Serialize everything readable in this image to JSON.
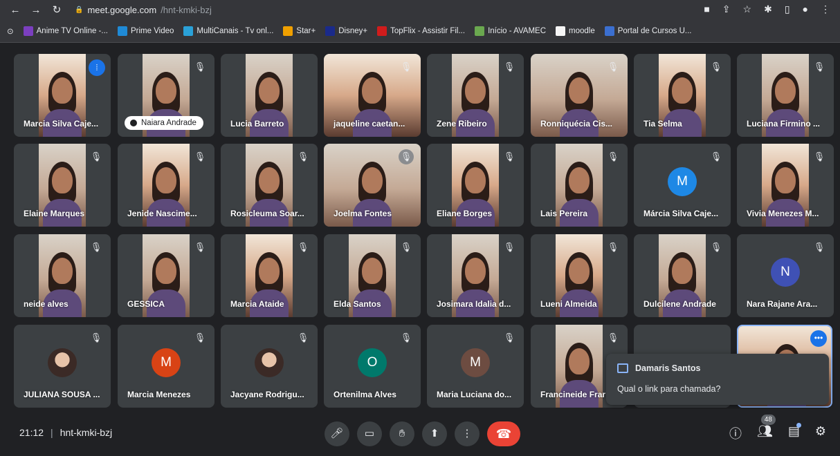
{
  "browser": {
    "url_domain": "meet.google.com",
    "url_path": "/hnt-kmki-bzj",
    "bookmarks": [
      {
        "label": "Anime TV Online -...",
        "color": "#7b3fbf"
      },
      {
        "label": "Prime Video",
        "color": "#1f8ad6"
      },
      {
        "label": "MultiCanais - Tv onl...",
        "color": "#2aa1d8"
      },
      {
        "label": "Star+",
        "color": "#f0a000"
      },
      {
        "label": "Disney+",
        "color": "#1a2a8a"
      },
      {
        "label": "TopFlix - Assistir Fil...",
        "color": "#d01c1c"
      },
      {
        "label": "Início - AVAMEC",
        "color": "#6aa84f"
      },
      {
        "label": "moodle",
        "color": "#f5f5f5"
      },
      {
        "label": "Portal de Cursos U...",
        "color": "#3b6fd0"
      }
    ]
  },
  "participants": [
    {
      "name": "Marcia Silva Caje...",
      "type": "video",
      "status": "speaking"
    },
    {
      "name": "Naiara Andrade",
      "type": "video",
      "status": "pinned"
    },
    {
      "name": "Lucia Barreto",
      "type": "video",
      "status": "none"
    },
    {
      "name": "jaqueline caetan...",
      "type": "video",
      "status": "muted"
    },
    {
      "name": "Zene Ribeiro",
      "type": "video",
      "status": "muted"
    },
    {
      "name": "Ronniquécia Cis...",
      "type": "video",
      "status": "muted"
    },
    {
      "name": "Tia Selma",
      "type": "video",
      "status": "muted"
    },
    {
      "name": "Luciana Firmino ...",
      "type": "video",
      "status": "muted"
    },
    {
      "name": "Elaine Marques",
      "type": "video",
      "status": "muted"
    },
    {
      "name": "Jenide Nascime...",
      "type": "video",
      "status": "muted"
    },
    {
      "name": "Rosicleuma Soar...",
      "type": "video",
      "status": "muted"
    },
    {
      "name": "Joelma Fontes",
      "type": "video",
      "status": "muted-pill"
    },
    {
      "name": "Eliane Borges",
      "type": "video",
      "status": "muted"
    },
    {
      "name": "Lais Pereira",
      "type": "video",
      "status": "muted"
    },
    {
      "name": "Márcia Silva Caje...",
      "type": "avatar",
      "initial": "M",
      "color": "#1e88e5",
      "status": "muted"
    },
    {
      "name": "Vivia Menezes M...",
      "type": "video",
      "status": "muted"
    },
    {
      "name": "neide alves",
      "type": "video",
      "status": "muted"
    },
    {
      "name": "GESSICA",
      "type": "video",
      "status": "muted"
    },
    {
      "name": "Marcia Ataide",
      "type": "video",
      "status": "muted"
    },
    {
      "name": "Elda Santos",
      "type": "video",
      "status": "muted"
    },
    {
      "name": "Josimara Idalia d...",
      "type": "video",
      "status": "muted"
    },
    {
      "name": "Lueni Almeida",
      "type": "video",
      "status": "muted"
    },
    {
      "name": "Dulcilene Andrade",
      "type": "video",
      "status": "muted"
    },
    {
      "name": "Nara Rajane Ara...",
      "type": "avatar",
      "initial": "N",
      "color": "#3f51b5",
      "status": "muted"
    },
    {
      "name": "JULIANA SOUSA ...",
      "type": "photo",
      "status": "muted"
    },
    {
      "name": "Marcia Menezes",
      "type": "avatar",
      "initial": "M",
      "color": "#d84315",
      "status": "muted"
    },
    {
      "name": "Jacyane Rodrigu...",
      "type": "photo",
      "status": "muted"
    },
    {
      "name": "Ortenilma Alves",
      "type": "avatar",
      "initial": "O",
      "color": "#00796b",
      "status": "muted"
    },
    {
      "name": "Maria Luciana do...",
      "type": "avatar",
      "initial": "M",
      "color": "#6d4c41",
      "status": "muted"
    },
    {
      "name": "Francineide Frar",
      "type": "video",
      "status": "muted"
    }
  ],
  "chat_popup": {
    "sender": "Damaris Santos",
    "message": "Qual o link para chamada?"
  },
  "bottom": {
    "time": "21:12",
    "meeting_code": "hnt-kmki-bzj",
    "participant_count": "48"
  }
}
